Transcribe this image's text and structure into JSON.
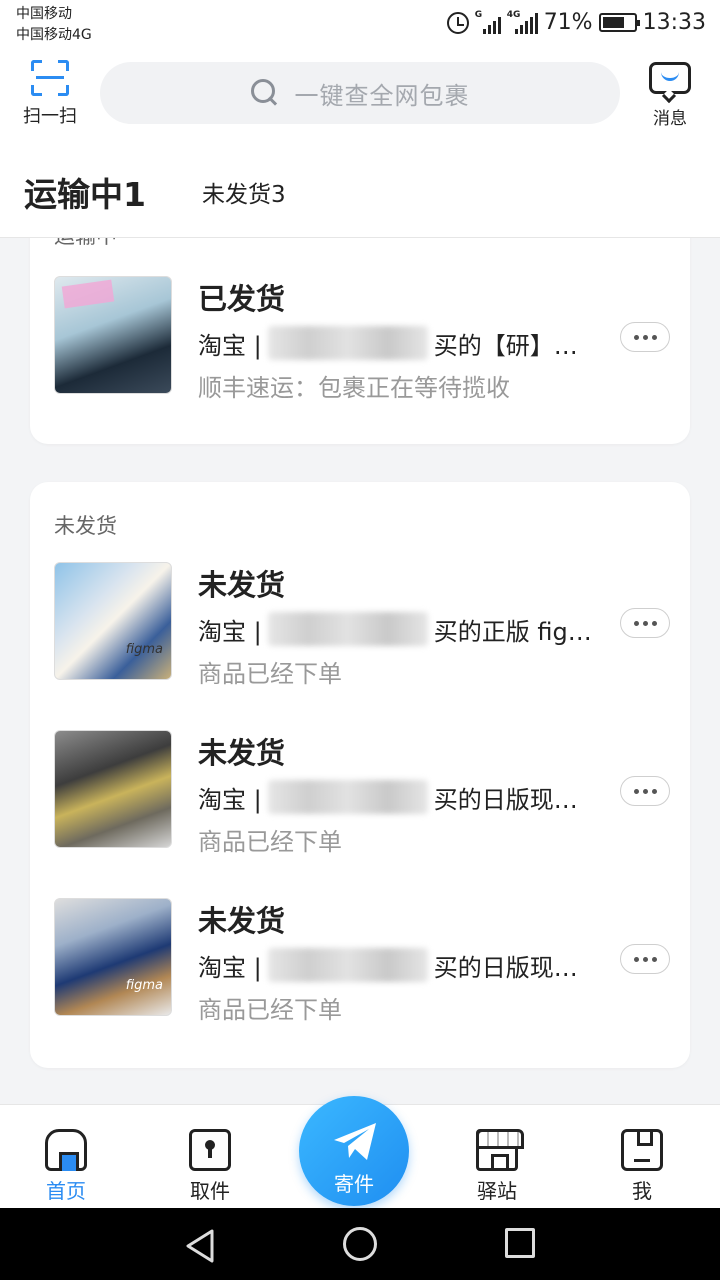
{
  "status_bar": {
    "carrier1": "中国移动",
    "carrier2": "中国移动4G",
    "network1": "G",
    "network2": "4G",
    "battery": "71%",
    "battery_level": 0.71,
    "time": "13:33"
  },
  "header": {
    "scan_label": "扫一扫",
    "search_placeholder": "一键查全网包裹",
    "messages_label": "消息"
  },
  "tabs": {
    "active": "运输中1",
    "other": "未发货3"
  },
  "sections": {
    "in_transit_label": "运输中",
    "unshipped_label": "未发货"
  },
  "packages": [
    {
      "status": "已发货",
      "desc_prefix": "淘宝 |",
      "desc_suffix": "买的【研】…",
      "sub": "顺丰速运：包裹正在等待揽收"
    },
    {
      "status": "未发货",
      "desc_prefix": "淘宝 |",
      "desc_suffix": "买的正版 fig…",
      "sub": "商品已经下单"
    },
    {
      "status": "未发货",
      "desc_prefix": "淘宝 |",
      "desc_suffix": "买的日版现…",
      "sub": "商品已经下单"
    },
    {
      "status": "未发货",
      "desc_prefix": "淘宝 |",
      "desc_suffix": "买的日版现…",
      "sub": "商品已经下单"
    }
  ],
  "bottom_nav": {
    "home": "首页",
    "pickup": "取件",
    "send": "寄件",
    "station": "驿站",
    "me": "我"
  },
  "colors": {
    "accent": "#2b8cf2",
    "send_button": "#1f8ef1"
  }
}
